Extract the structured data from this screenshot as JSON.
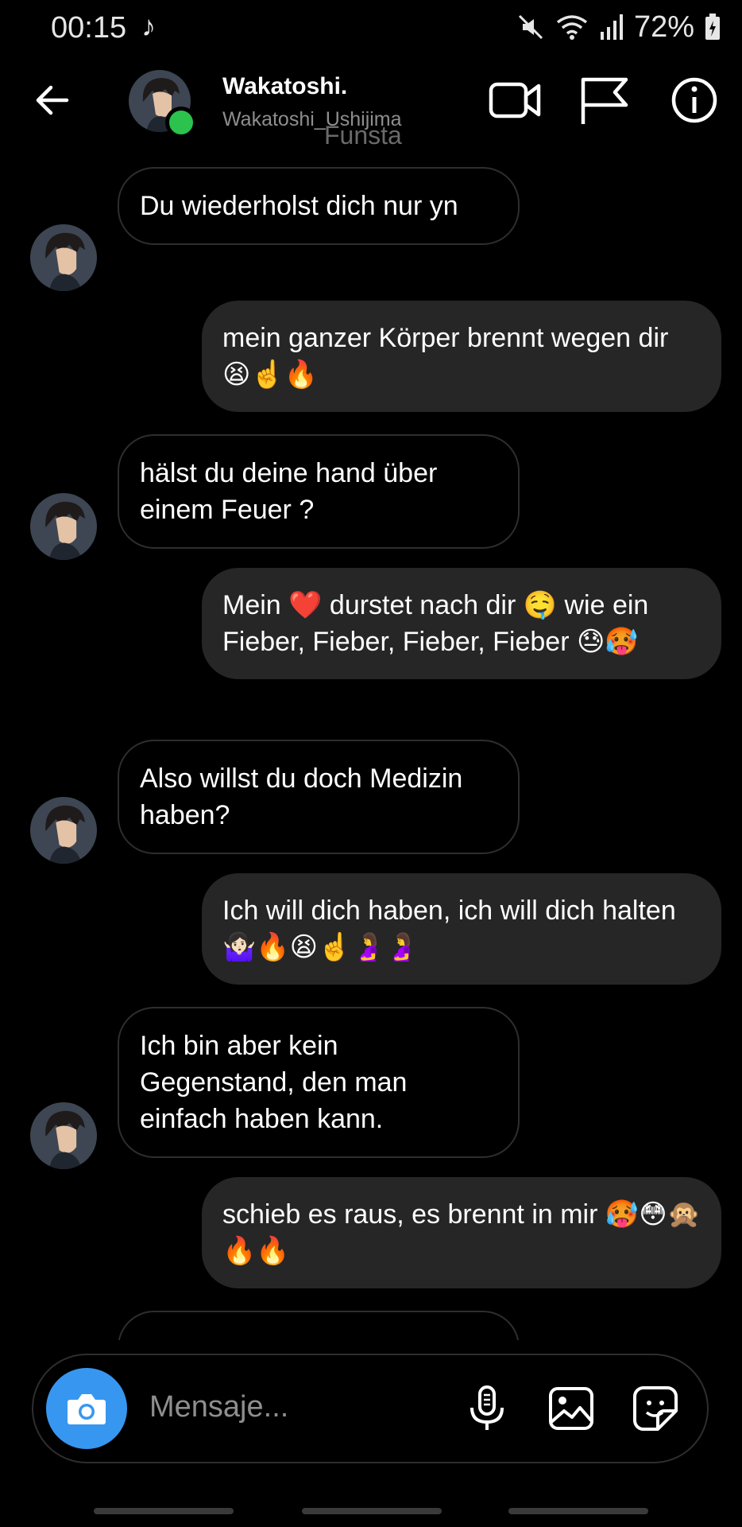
{
  "status_bar": {
    "time": "00:15",
    "music_glyph": "♪",
    "battery": "72%"
  },
  "header": {
    "display_name": "Wakatoshi.",
    "username": "Wakatoshi_Ushijima",
    "faded_label": "Funsta",
    "icons": [
      "back-arrow-icon",
      "video-call-icon",
      "flag-icon",
      "info-icon"
    ]
  },
  "messages": [
    {
      "direction": "incoming",
      "text": "Du wiederholst dich nur yn"
    },
    {
      "direction": "outgoing",
      "text": "mein ganzer Körper brennt wegen dir 😫☝️🔥"
    },
    {
      "direction": "incoming",
      "text": "hälst du deine hand über einem Feuer ?"
    },
    {
      "direction": "outgoing",
      "text": "Mein ❤️ durstet nach dir 🤤 wie ein Fieber, Fieber, Fieber, Fieber 😓🥵"
    },
    {
      "direction": "incoming",
      "text": "Also willst du doch Medizin haben?"
    },
    {
      "direction": "outgoing",
      "text": "Ich will dich haben, ich will dich halten 🤷🏻‍♀️🔥😫☝️🤰🤰"
    },
    {
      "direction": "incoming",
      "text": "Ich bin aber kein Gegenstand, den man einfach haben kann."
    },
    {
      "direction": "outgoing",
      "text": "schieb es raus, es brennt in mir 🥵😳🙊🔥🔥"
    }
  ],
  "composer": {
    "placeholder": "Mensaje...",
    "icons": [
      "camera-icon",
      "microphone-icon",
      "gallery-icon",
      "sticker-icon"
    ]
  },
  "colors": {
    "background": "#000000",
    "outgoing_bubble": "#262626",
    "camera_button": "#3797f0",
    "online": "#2bc24d"
  }
}
